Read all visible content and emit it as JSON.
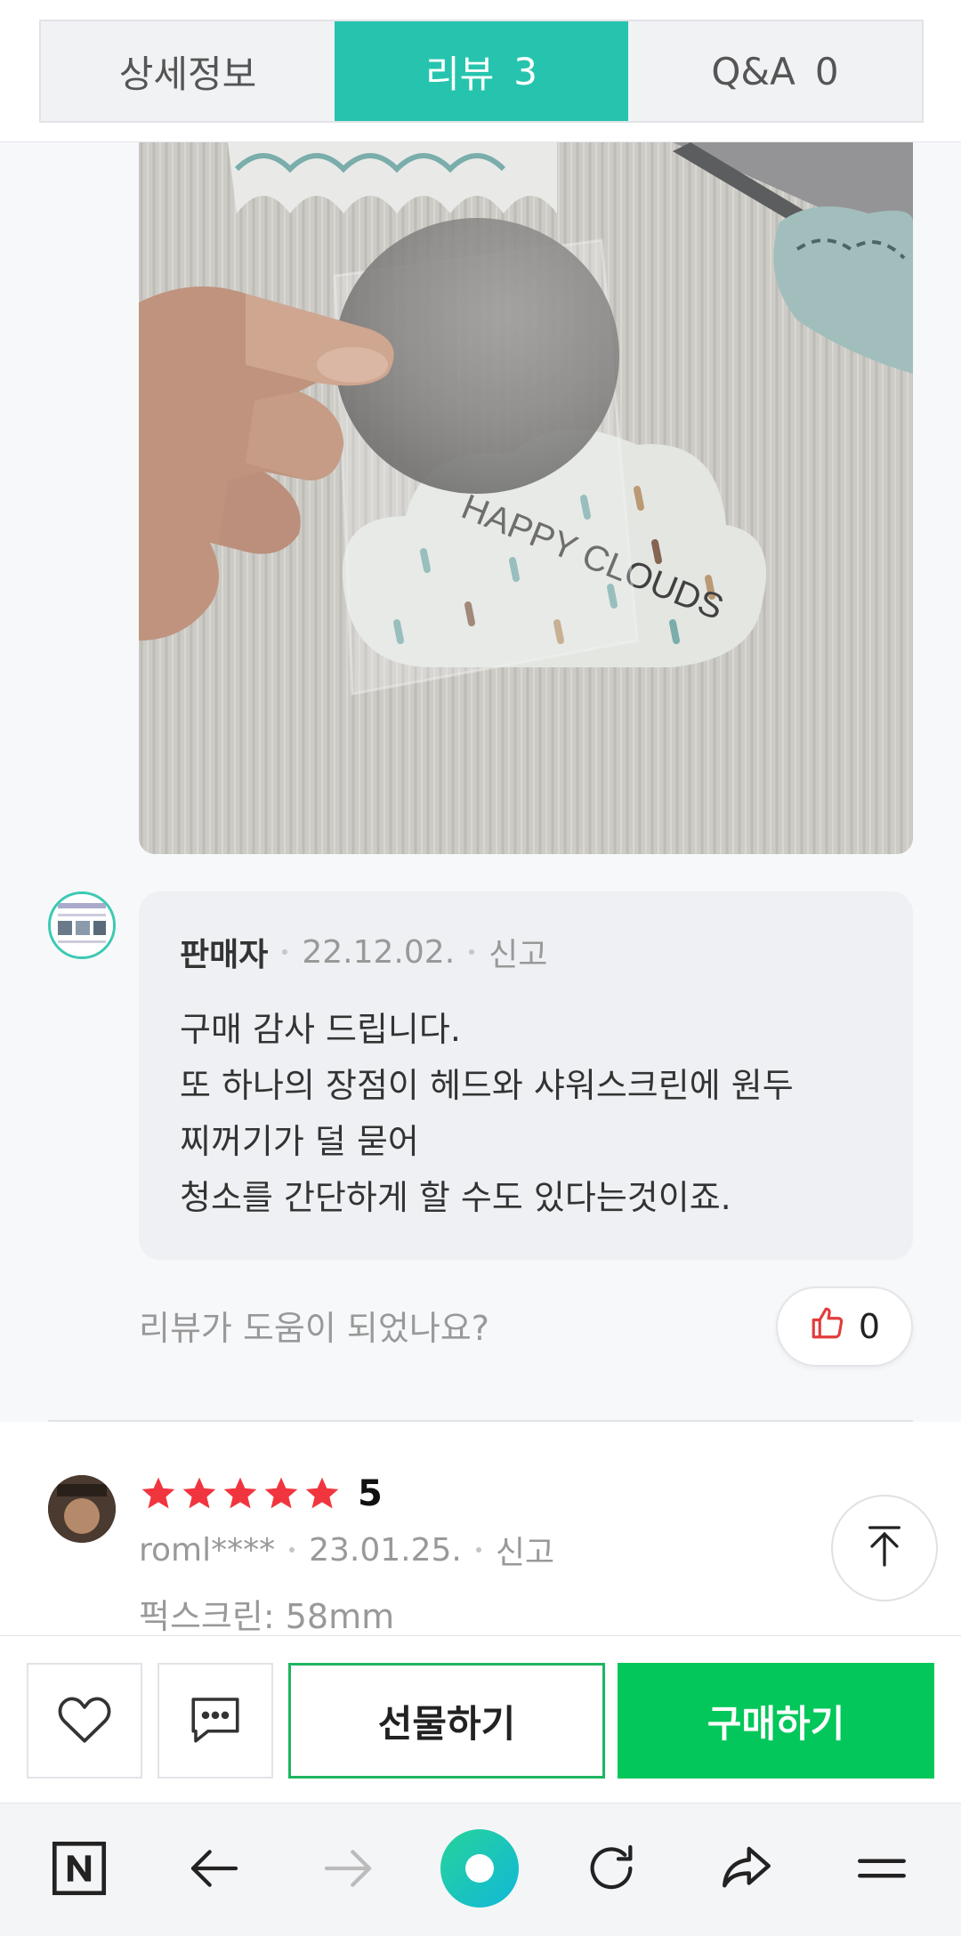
{
  "tabs": [
    {
      "label": "상세정보",
      "count": ""
    },
    {
      "label": "리뷰",
      "count": "3"
    },
    {
      "label": "Q&A",
      "count": "0"
    }
  ],
  "photo": {
    "printed_text": "HAPPY CLOUDS"
  },
  "seller_reply": {
    "author": "판매자",
    "date": "22.12.02.",
    "report": "신고",
    "lines": [
      "구매 감사 드립니다.",
      "또 하나의 장점이 헤드와 샤워스크린에 원두",
      "찌꺼기가 덜 묻어",
      "청소를 간단하게 할 수도 있다는것이죠."
    ]
  },
  "helpful": {
    "question": "리뷰가 도움이 되었나요?",
    "count": "0"
  },
  "next_review": {
    "stars": 5,
    "rating": "5",
    "user": "roml****",
    "date": "23.01.25.",
    "report": "신고",
    "option": "퍽스크린: 58mm"
  },
  "buybar": {
    "gift_label": "선물하기",
    "buy_label": "구매하기"
  },
  "colors": {
    "accent": "#26c4ae",
    "buy_green": "#03c75a",
    "star_red": "#f0353f"
  },
  "icons": [
    "heart-icon",
    "chat-icon",
    "thumbs-up-icon",
    "arrow-up-icon",
    "naver-icon",
    "back-arrow-icon",
    "forward-arrow-icon",
    "home-circle-icon",
    "refresh-icon",
    "share-icon",
    "menu-icon"
  ]
}
